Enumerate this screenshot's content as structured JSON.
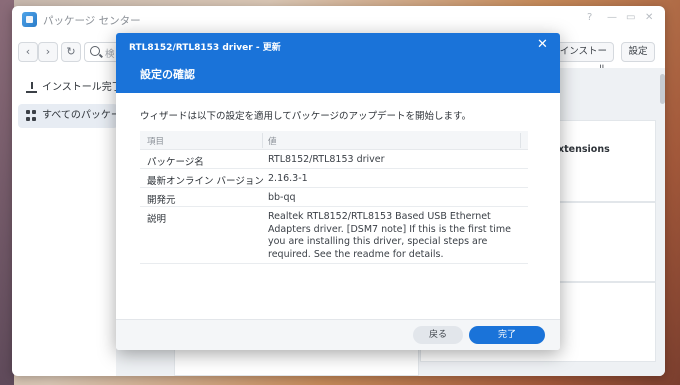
{
  "app": {
    "title": "パッケージ センター",
    "window_controls": [
      "?",
      "—",
      "▭",
      "✕"
    ]
  },
  "toolbar": {
    "back_icon": "‹",
    "forward_icon": "›",
    "refresh_icon": "↻",
    "search_placeholder": "検",
    "install_label": "インストール",
    "settings_label": "設定"
  },
  "sidebar": {
    "items": [
      {
        "label": "インストール完了",
        "icon": "download-icon"
      },
      {
        "label": "すべてのパッケージ",
        "icon": "grid-icon"
      }
    ]
  },
  "background": {
    "card_title": "xtensions"
  },
  "dialog": {
    "title": "RTL8152/RTL8153 driver - 更新",
    "close_icon": "✕",
    "heading": "設定の確認",
    "intro": "ウィザードは以下の設定を適用してパッケージのアップデートを開始します。",
    "table": {
      "headers": [
        "項目",
        "値"
      ],
      "rows": [
        {
          "key": "パッケージ名",
          "value": "RTL8152/RTL8153 driver"
        },
        {
          "key": "最新オンライン バージョン",
          "value": "2.16.3-1"
        },
        {
          "key": "開発元",
          "value": "bb-qq"
        },
        {
          "key": "説明",
          "value": "Realtek RTL8152/RTL8153 Based USB Ethernet Adapters driver. [DSM7 note] If this is the first time you are installing this driver, special steps are required. See the readme for details."
        }
      ]
    },
    "back_label": "戻る",
    "done_label": "完了"
  }
}
